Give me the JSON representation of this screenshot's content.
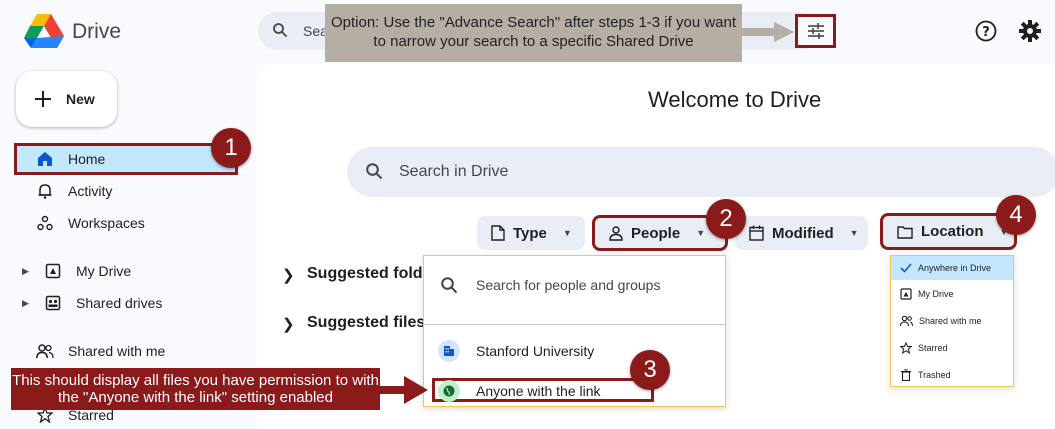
{
  "app": {
    "name": "Drive"
  },
  "top_search": {
    "placeholder": "Sea"
  },
  "callouts": {
    "advanced": "Option: Use the \"Advance Search\" after steps 1-3 if you want to narrow your search to a specific Shared Drive",
    "anyone": "This should display all files you have permission to with the \"Anyone with the link\" setting enabled"
  },
  "sidebar": {
    "new_label": "New",
    "items": [
      {
        "label": "Home"
      },
      {
        "label": "Activity"
      },
      {
        "label": "Workspaces"
      },
      {
        "label": "My Drive"
      },
      {
        "label": "Shared drives"
      },
      {
        "label": "Shared with me"
      },
      {
        "label": "Starred"
      }
    ]
  },
  "main": {
    "welcome": "Welcome to Drive",
    "search_placeholder": "Search in Drive",
    "chips": [
      {
        "label": "Type"
      },
      {
        "label": "People"
      },
      {
        "label": "Modified"
      },
      {
        "label": "Location"
      }
    ],
    "suggested_folders": "Suggested folde",
    "suggested_files": "Suggested files"
  },
  "people_dropdown": {
    "search_placeholder": "Search for people and groups",
    "options": [
      {
        "label": "Stanford University"
      },
      {
        "label": "Anyone with the link"
      }
    ]
  },
  "location_dropdown": {
    "options": [
      {
        "label": "Anywhere in Drive",
        "selected": true
      },
      {
        "label": "My Drive"
      },
      {
        "label": "Shared with me"
      },
      {
        "label": "Starred"
      },
      {
        "label": "Trashed"
      }
    ]
  },
  "badges": [
    "1",
    "2",
    "3",
    "4"
  ],
  "colors": {
    "annotation": "#8b1a1a",
    "selected": "#c2e7ff",
    "surface": "#e9eef6"
  }
}
